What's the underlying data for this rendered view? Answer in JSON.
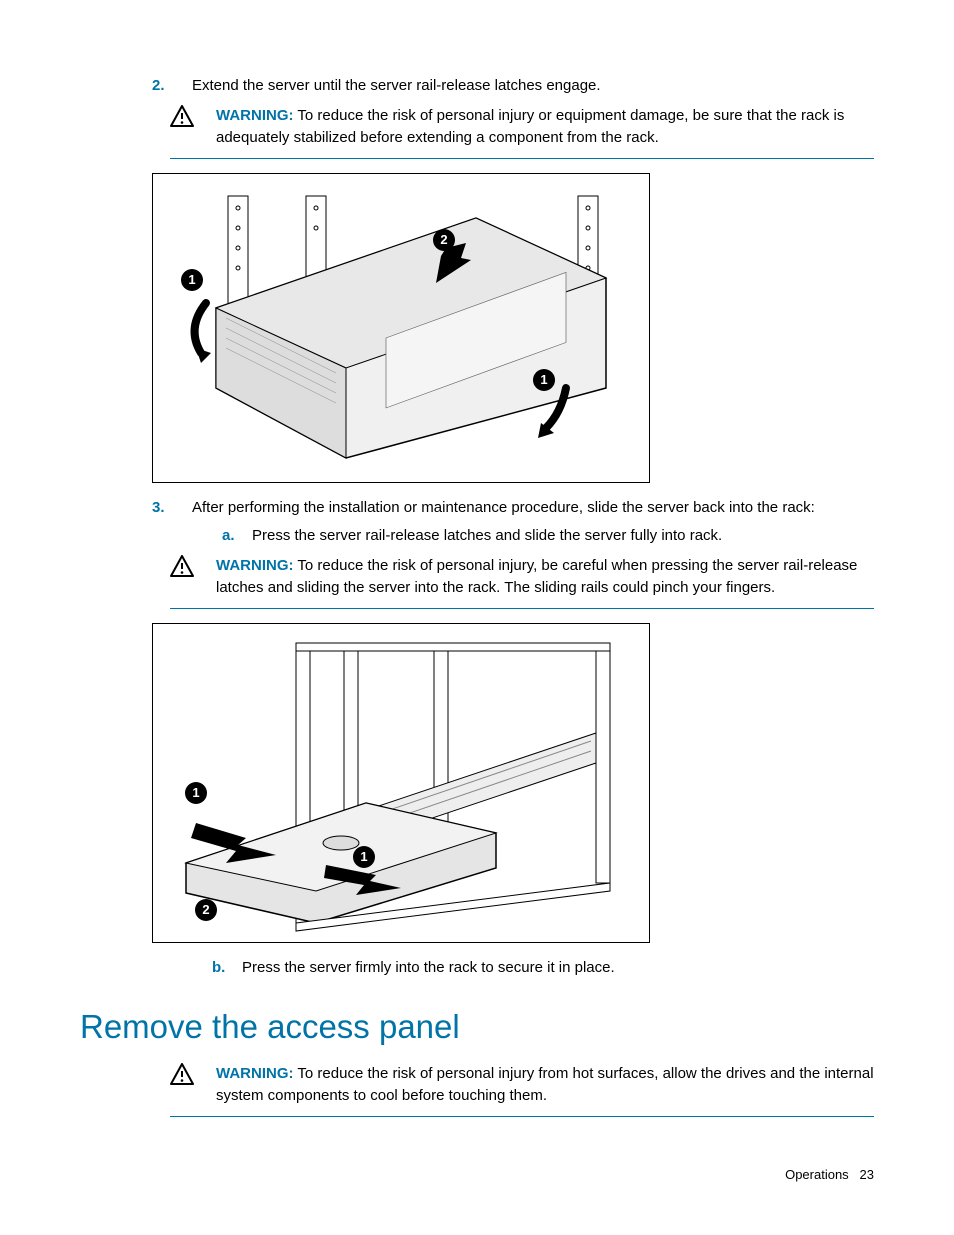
{
  "steps": {
    "step2": {
      "num": "2.",
      "text": "Extend the server until the server rail-release latches engage."
    },
    "step3": {
      "num": "3.",
      "text": "After performing the installation or maintenance procedure, slide the server back into the rack:",
      "sub_a": {
        "num": "a.",
        "text": "Press the server rail-release latches and slide the server fully into rack."
      },
      "sub_b": {
        "num": "b.",
        "text": "Press the server firmly into the rack to secure it in place."
      }
    }
  },
  "warnings": {
    "label": "WARNING:",
    "w1": "To reduce the risk of personal injury or equipment damage, be sure that the rack is adequately stabilized before extending a component from the rack.",
    "w2": "To reduce the risk of personal injury, be careful when pressing the server rail-release latches and sliding the server into the rack. The sliding rails could pinch your fingers.",
    "w3": "To reduce the risk of personal injury from hot surfaces, allow the drives and the internal system components to cool before touching them."
  },
  "section_heading": "Remove the access panel",
  "footer": {
    "section": "Operations",
    "page": "23"
  },
  "callouts": {
    "one": "1",
    "two": "2"
  }
}
